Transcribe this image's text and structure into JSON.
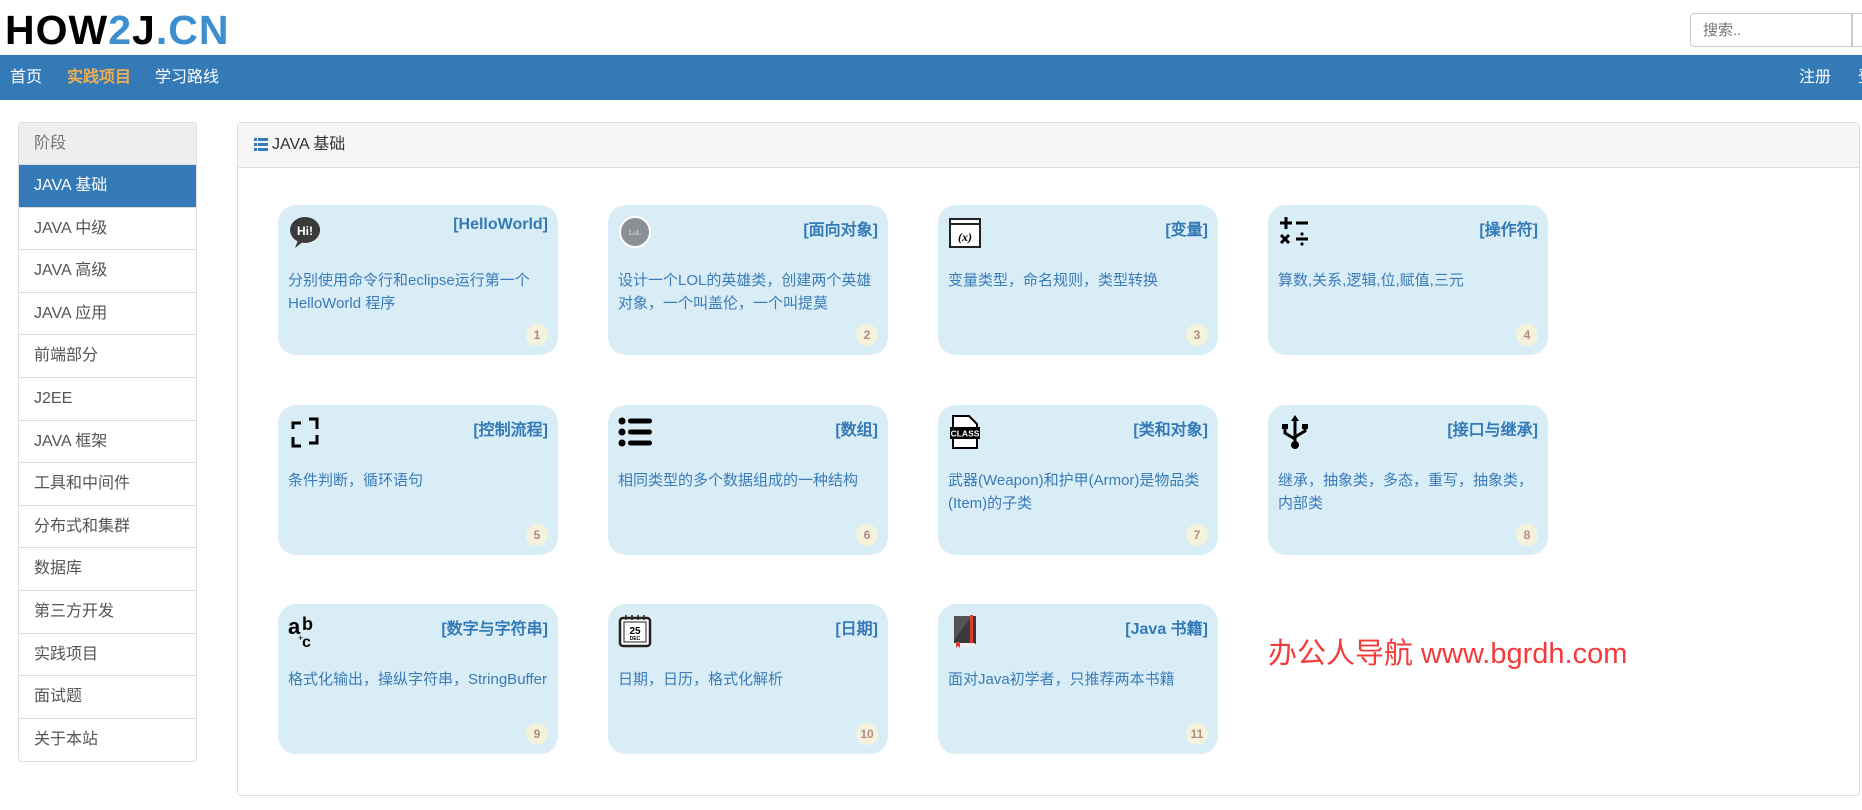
{
  "logo": {
    "text_black": "HOW",
    "text_2": "2",
    "text_j": "J",
    "text_dot": ".",
    "text_cn": "CN"
  },
  "search": {
    "placeholder": "搜索.."
  },
  "nav": {
    "items": [
      {
        "label": "首页"
      },
      {
        "label": "实践项目",
        "active": true
      },
      {
        "label": "学习路线"
      }
    ],
    "right": [
      {
        "label": "注册"
      },
      {
        "label": "登"
      }
    ]
  },
  "sidebar": {
    "header": "阶段",
    "items": [
      {
        "label": "JAVA 基础",
        "active": true
      },
      {
        "label": "JAVA 中级"
      },
      {
        "label": "JAVA 高级"
      },
      {
        "label": "JAVA 应用"
      },
      {
        "label": "前端部分"
      },
      {
        "label": "J2EE"
      },
      {
        "label": "JAVA 框架"
      },
      {
        "label": "工具和中间件"
      },
      {
        "label": "分布式和集群"
      },
      {
        "label": "数据库"
      },
      {
        "label": "第三方开发"
      },
      {
        "label": "实践项目"
      },
      {
        "label": "面试题"
      },
      {
        "label": "关于本站"
      }
    ]
  },
  "panel": {
    "title": "JAVA 基础",
    "icon": "list-icon"
  },
  "cards": [
    {
      "title": "[HelloWorld]",
      "desc": "分别使用命令行和eclipse运行第一个HelloWorld 程序",
      "num": "1",
      "icon": "hi-speech-bubble-icon"
    },
    {
      "title": "[面向对象]",
      "desc": "设计一个LOL的英雄类，创建两个英雄对象，一个叫盖伦，一个叫提莫",
      "num": "2",
      "icon": "league-of-legends-icon"
    },
    {
      "title": "[变量]",
      "desc": "变量类型，命名规则，类型转换",
      "num": "3",
      "icon": "variable-x-icon"
    },
    {
      "title": "[操作符]",
      "desc": "算数,关系,逻辑,位,赋值,三元",
      "num": "4",
      "icon": "math-operators-icon"
    },
    {
      "title": "[控制流程]",
      "desc": "条件判断，循环语句",
      "num": "5",
      "icon": "loop-arrows-icon"
    },
    {
      "title": "[数组]",
      "desc": "相同类型的多个数据组成的一种结构",
      "num": "6",
      "icon": "bullet-list-icon"
    },
    {
      "title": "[类和对象]",
      "desc": "武器(Weapon)和护甲(Armor)是物品类(Item)的子类",
      "num": "7",
      "icon": "class-file-icon"
    },
    {
      "title": "[接口与继承]",
      "desc": "继承，抽象类，多态，重写，抽象类，内部类",
      "num": "8",
      "icon": "usb-icon"
    },
    {
      "title": "[数字与字符串]",
      "desc": "格式化输出，操纵字符串，StringBuffer",
      "num": "9",
      "icon": "abc-text-icon"
    },
    {
      "title": "[日期]",
      "desc": "日期，日历，格式化解析",
      "num": "10",
      "icon": "calendar-icon",
      "icon_text": "25",
      "icon_sub": "DEC"
    },
    {
      "title": "[Java 书籍]",
      "desc": "面对Java初学者，只推荐两本书籍",
      "num": "11",
      "icon": "book-icon"
    }
  ],
  "watermark": "办公人导航  www.bgrdh.com",
  "colors": {
    "nav_bg": "#337ab7",
    "nav_active": "#f0ad4e",
    "card_bg": "#d9edf7",
    "card_text": "#337ab7",
    "watermark": "#f33b3b"
  }
}
